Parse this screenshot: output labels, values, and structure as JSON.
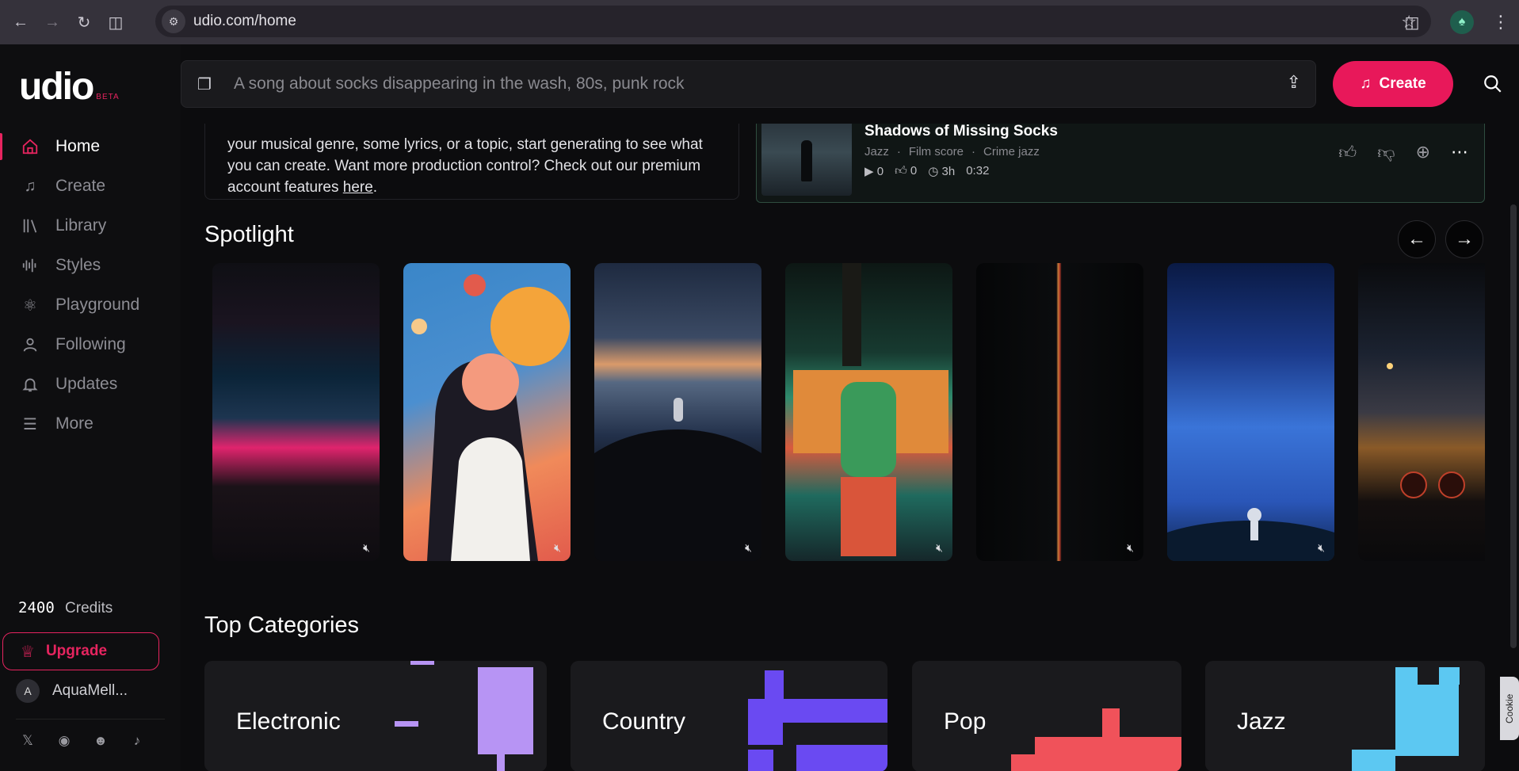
{
  "browser": {
    "url": "udio.com/home"
  },
  "app": {
    "logo": "udio",
    "beta": "BETA"
  },
  "sidebar": {
    "items": [
      {
        "label": "Home",
        "icon": "home-icon"
      },
      {
        "label": "Create",
        "icon": "music-note-icon"
      },
      {
        "label": "Library",
        "icon": "library-icon"
      },
      {
        "label": "Styles",
        "icon": "waveform-icon"
      },
      {
        "label": "Playground",
        "icon": "atom-icon"
      },
      {
        "label": "Following",
        "icon": "user-icon"
      },
      {
        "label": "Updates",
        "icon": "bell-icon"
      },
      {
        "label": "More",
        "icon": "menu-icon"
      }
    ],
    "credits_value": "2400",
    "credits_label": "Credits",
    "upgrade_label": "Upgrade",
    "user_initial": "A",
    "user_name": "AquaMell..."
  },
  "topbar": {
    "search_placeholder": "A song about socks disappearing in the wash, 80s, punk rock",
    "create_label": "Create"
  },
  "intro": {
    "text": "your musical genre, some lyrics, or a topic, start generating to see what you can create. Want more production control? Check out our premium account features ",
    "link": "here",
    "tail": "."
  },
  "song": {
    "title": "Shadows of Missing Socks",
    "tags": [
      "Jazz",
      "Film score",
      "Crime jazz"
    ],
    "plays": "0",
    "likes": "0",
    "age": "3h",
    "duration": "0:32"
  },
  "spotlight": {
    "title": "Spotlight"
  },
  "categories": {
    "title": "Top Categories",
    "items": [
      "Electronic",
      "Country",
      "Pop",
      "Jazz"
    ]
  },
  "cookie": {
    "label": "Cookie"
  },
  "colors": {
    "accent": "#e6245f",
    "create_button": "#e8185a",
    "song_border": "#2f4d3f",
    "electronic": "#b794f4",
    "country": "#6a4af2",
    "pop": "#f0525a",
    "jazz": "#5cc8f2"
  }
}
